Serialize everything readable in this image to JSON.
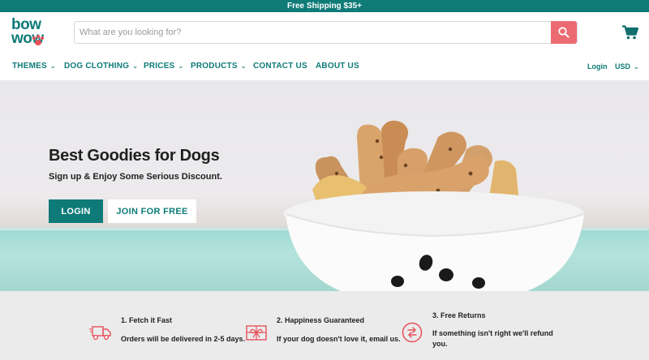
{
  "promo": {
    "text": "Free Shipping $35+"
  },
  "brand": {
    "line1": "bow",
    "line2": "wow"
  },
  "search": {
    "placeholder": "What are you looking for?"
  },
  "nav": {
    "items": [
      {
        "label": "THEMES",
        "has_dropdown": true
      },
      {
        "label": "DOG CLOTHING",
        "has_dropdown": true
      },
      {
        "label": "PRICES",
        "has_dropdown": true
      },
      {
        "label": "PRODUCTS",
        "has_dropdown": true
      },
      {
        "label": "CONTACT US",
        "has_dropdown": false
      },
      {
        "label": "ABOUT US",
        "has_dropdown": false
      }
    ],
    "login": "Login",
    "currency": "USD"
  },
  "hero": {
    "title": "Best Goodies for Dogs",
    "subtitle": "Sign up & Enjoy Some Serious Discount.",
    "login_button": "LOGIN",
    "join_button": "JOIN FOR FREE"
  },
  "features": [
    {
      "icon": "delivery-truck-icon",
      "title": "1. Fetch it Fast",
      "description": "Orders will be delivered in 2-5 days."
    },
    {
      "icon": "gift-icon",
      "title": "2. Happiness Guaranteed",
      "description": "If your dog doesn't love it, email us."
    },
    {
      "icon": "returns-icon",
      "title": "3. Free Returns",
      "description": "If something isn't right we'll refund you."
    }
  ],
  "colors": {
    "brand_teal": "#0e7b78",
    "accent_pink": "#ec6b73",
    "paw_red": "#e8505b"
  }
}
